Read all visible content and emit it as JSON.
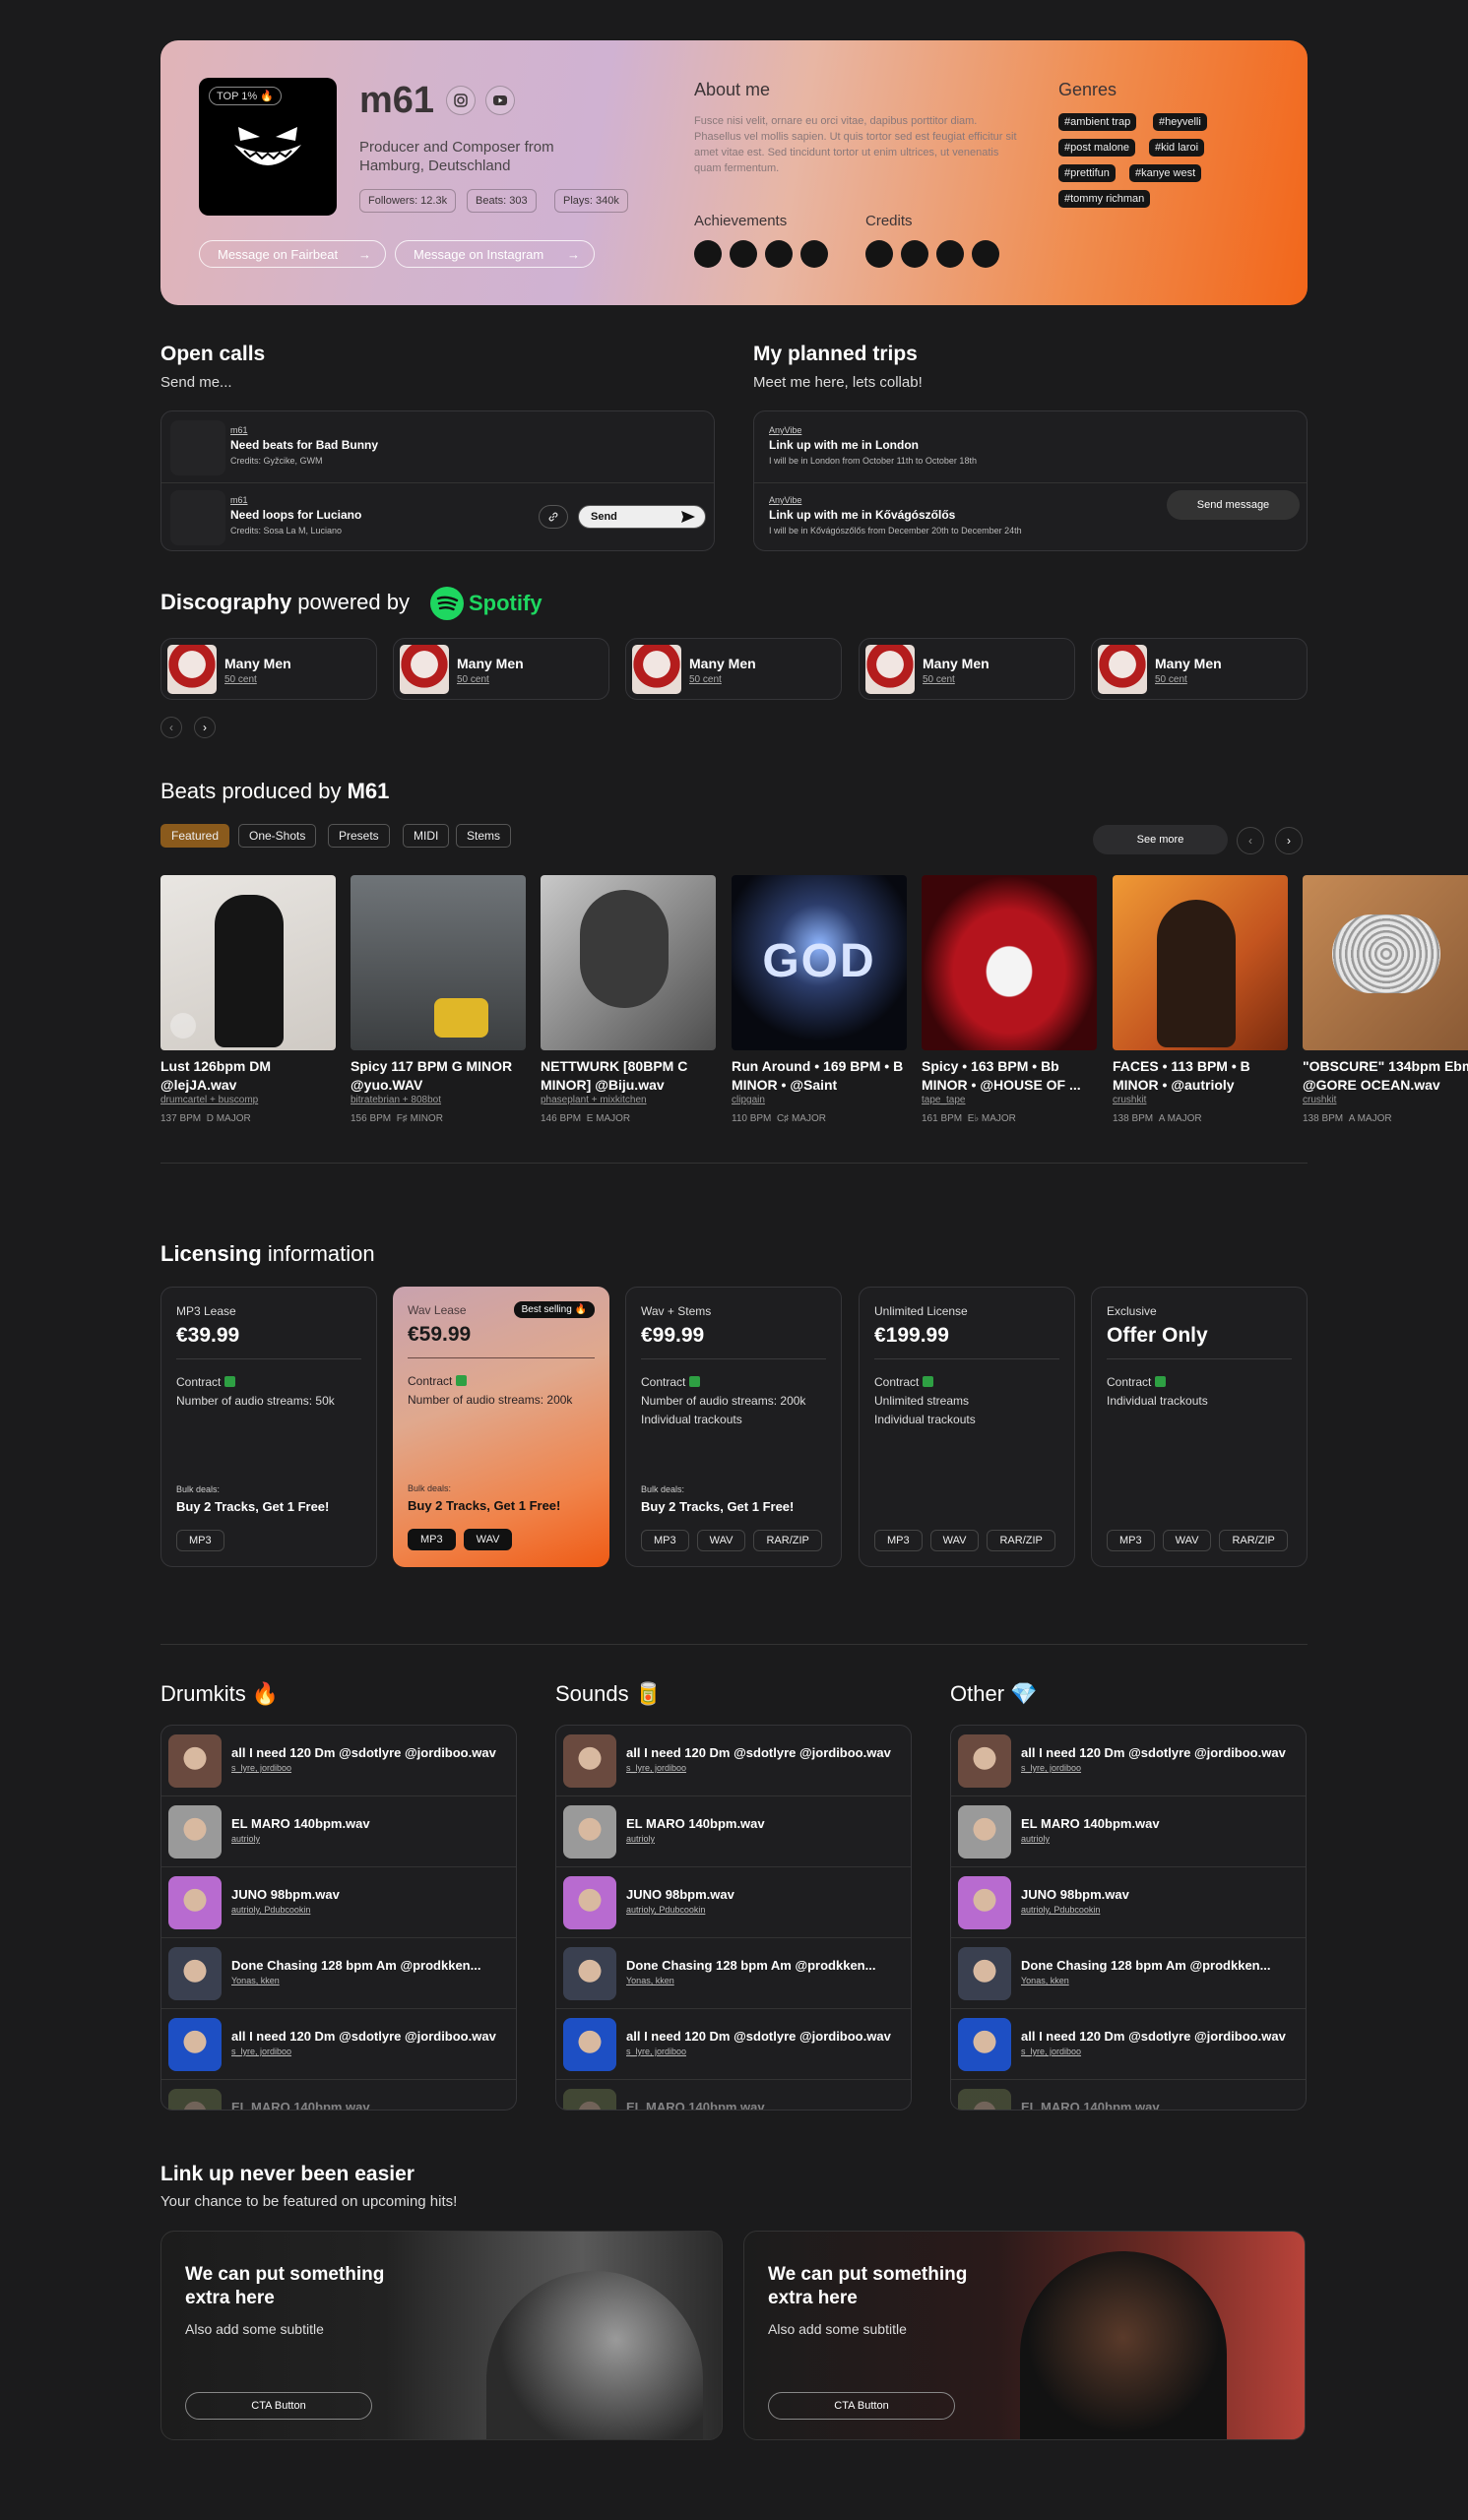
{
  "profile": {
    "badge": "TOP 1% 🔥",
    "name": "m61",
    "subtitle": "Producer and Composer from Hamburg, Deutschland",
    "stats": [
      "Followers: 12.3k",
      "Beats: 303",
      "Plays: 340k"
    ],
    "buttons": [
      "Message on Fairbeat",
      "Message on Instagram"
    ],
    "about_title": "About me",
    "about_text": "Fusce nisi velit, ornare eu orci vitae, dapibus porttitor diam. Phasellus vel mollis sapien. Ut quis tortor sed est feugiat efficitur sit amet vitae est. Sed tincidunt tortor ut enim ultrices, ut venenatis quam fermentum.",
    "achievements_title": "Achievements",
    "credits_title": "Credits",
    "genres_title": "Genres",
    "genres": [
      "#ambient trap",
      "#heyvelli",
      "#post malone",
      "#kid laroi",
      "#prettifun",
      "#kanye west",
      "#tommy richman"
    ]
  },
  "open_calls": {
    "title": "Open calls",
    "subtitle": "Send me...",
    "items": [
      {
        "user": "m61",
        "title": "Need beats for Bad Bunny",
        "credits": "Credits: Gyžcike, GWM"
      },
      {
        "user": "m61",
        "title": "Need loops for Luciano",
        "credits": "Credits: Sosa La M, Luciano"
      }
    ],
    "send_label": "Send"
  },
  "trips": {
    "title": "My planned trips",
    "subtitle": "Meet me here, lets collab!",
    "items": [
      {
        "user": "AnyVibe",
        "title": "Link up with me in London",
        "desc": "I will be in London from October 11th to October 18th"
      },
      {
        "user": "AnyVibe",
        "title": "Link up with me in Kővágószőlős",
        "desc": "I will be in Kővágószőlős from December 20th to December 24th"
      }
    ],
    "send_message": "Send message"
  },
  "discography": {
    "title_bold": "Discography",
    "title_rest": "powered by",
    "spotify": "Spotify",
    "items": [
      {
        "title": "Many Men",
        "artist": "50 cent"
      },
      {
        "title": "Many Men",
        "artist": "50 cent"
      },
      {
        "title": "Many Men",
        "artist": "50 cent"
      },
      {
        "title": "Many Men",
        "artist": "50 cent"
      },
      {
        "title": "Many Men",
        "artist": "50 cent"
      }
    ]
  },
  "beats": {
    "title_pre": "Beats produced by",
    "title_name": "M61",
    "filters": [
      "Featured",
      "One-Shots",
      "Presets",
      "MIDI",
      "Stems"
    ],
    "see_more": "See more",
    "items": [
      {
        "title": "Lust 126bpm DM @lejJA.wav",
        "producer": "drumcartel + buscomp",
        "bpm": "137 BPM",
        "key": "D MAJOR",
        "color": "#d9d6d3"
      },
      {
        "title": "Spicy 117 BPM G MINOR @yuo.WAV",
        "producer": "bitratebrian + 808bot",
        "bpm": "156 BPM",
        "key": "F♯ MINOR",
        "color": "#555a5e"
      },
      {
        "title": "NETTWURK [80BPM C MINOR] @Biju.wav",
        "producer": "phaseplant + mixkitchen",
        "bpm": "146 BPM",
        "key": "E MAJOR",
        "color": "#8c8c8c"
      },
      {
        "title": "Run Around • 169 BPM • B MINOR • @Saint",
        "producer": "clipgain",
        "bpm": "110 BPM",
        "key": "C♯ MAJOR",
        "color": "#101524"
      },
      {
        "title": "Spicy • 163 BPM • Bb MINOR • @HOUSE OF ...",
        "producer": "tape_tape",
        "bpm": "161 BPM",
        "key": "E♭ MAJOR",
        "color": "#5a0c12"
      },
      {
        "title": "FACES • 113 BPM • B MINOR • @autrioly",
        "producer": "crushkit",
        "bpm": "138 BPM",
        "key": "A MAJOR",
        "color": "#d4702a"
      },
      {
        "title": "\"OBSCURE\" 134bpm Ebm @GORE OCEAN.wav",
        "producer": "crushkit",
        "bpm": "138 BPM",
        "key": "A MAJOR",
        "color": "#a9744a"
      }
    ]
  },
  "licensing": {
    "title_bold": "Licensing",
    "title_rest": "information",
    "best_selling": "Best selling 🔥",
    "contract": "Contract",
    "bulk_label": "Bulk deals:",
    "bulk_value": "Buy 2 Tracks, Get 1 Free!",
    "plans": [
      {
        "name": "MP3 Lease",
        "price": "€39.99",
        "features": [
          "Number of audio streams: 50k"
        ],
        "bulk": true,
        "formats": [
          "MP3"
        ]
      },
      {
        "name": "Wav Lease",
        "price": "€59.99",
        "features": [
          "Number of audio streams: 200k"
        ],
        "bulk": true,
        "formats": [
          "MP3",
          "WAV"
        ]
      },
      {
        "name": "Wav + Stems",
        "price": "€99.99",
        "features": [
          "Number of audio streams: 200k",
          "Individual trackouts"
        ],
        "bulk": true,
        "formats": [
          "MP3",
          "WAV",
          "RAR/ZIP"
        ]
      },
      {
        "name": "Unlimited License",
        "price": "€199.99",
        "features": [
          "Unlimited streams",
          "Individual trackouts"
        ],
        "bulk": false,
        "formats": [
          "MP3",
          "WAV",
          "RAR/ZIP"
        ]
      },
      {
        "name": "Exclusive",
        "price": "Offer Only",
        "features": [
          "Individual trackouts"
        ],
        "bulk": false,
        "formats": [
          "MP3",
          "WAV",
          "RAR/ZIP"
        ]
      }
    ]
  },
  "kits": [
    {
      "title": "Drumkits 🔥"
    },
    {
      "title": "Sounds 🥫"
    },
    {
      "title": "Other 💎"
    }
  ],
  "kit_items": [
    {
      "title": "all I need 120 Dm @sdotlyre @jordiboo.wav",
      "authors": "s_lyre, jordiboo",
      "color": "#6a4a3f"
    },
    {
      "title": "EL MARO 140bpm.wav",
      "authors": "autrioly",
      "color": "#9a9a9a"
    },
    {
      "title": "JUNO 98bpm.wav",
      "authors": "autrioly, Pdubcookin",
      "color": "#b86bd0"
    },
    {
      "title": "Done Chasing 128 bpm Am @prodkken...",
      "authors": "Yonas, kken",
      "color": "#3a4050"
    },
    {
      "title": "all I need 120 Dm @sdotlyre @jordiboo.wav",
      "authors": "s_lyre, jordiboo",
      "color": "#1d4fc4"
    },
    {
      "title": "EL MARO 140bpm.wav",
      "authors": "",
      "color": "#6e7a4e"
    }
  ],
  "linkup": {
    "title": "Link up never been easier",
    "subtitle": "Your chance to be featured on upcoming hits!",
    "cards": [
      {
        "title": "We can put something extra here",
        "subtitle": "Also add some subtitle",
        "button": "CTA Button"
      },
      {
        "title": "We can put something extra here",
        "subtitle": "Also add some subtitle",
        "button": "CTA Button"
      }
    ]
  }
}
